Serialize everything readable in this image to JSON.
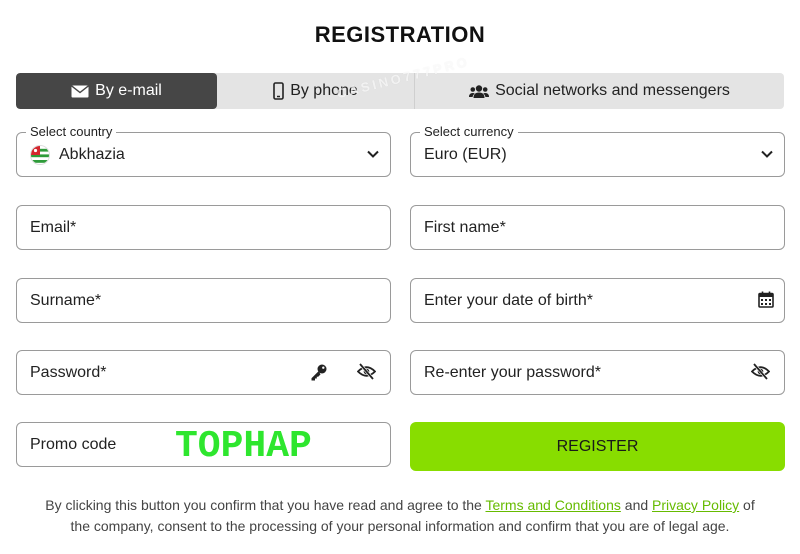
{
  "title": "REGISTRATION",
  "tabs": [
    {
      "label": "By e-mail",
      "icon": "envelope-icon",
      "active": true
    },
    {
      "label": "By phone",
      "icon": "phone-icon",
      "active": false
    },
    {
      "label": "Social networks and messengers",
      "icon": "users-icon",
      "active": false
    }
  ],
  "watermark": "CASINO777PRO",
  "country": {
    "legend": "Select country",
    "value": "Abkhazia",
    "icon": "abkhazia-flag-icon"
  },
  "currency": {
    "legend": "Select currency",
    "value": "Euro (EUR)"
  },
  "fields": {
    "email": "Email*",
    "first_name": "First name*",
    "surname": "Surname*",
    "dob": "Enter your date of birth*",
    "password": "Password*",
    "password_repeat": "Re-enter your password*",
    "promo": "Promo code"
  },
  "promo_value": "TOPHAP",
  "register_label": "REGISTER",
  "disclaimer": {
    "before": "By clicking this button you confirm that you have read and agree to the ",
    "terms": "Terms and Conditions",
    "and": " and ",
    "privacy": "Privacy Policy",
    "after": " of the company, consent to the processing of your personal information and confirm that you are of legal age."
  },
  "colors": {
    "accent": "#88dd00",
    "tab_active": "#464646",
    "link": "#66bb00",
    "promo": "#2ee62e"
  }
}
